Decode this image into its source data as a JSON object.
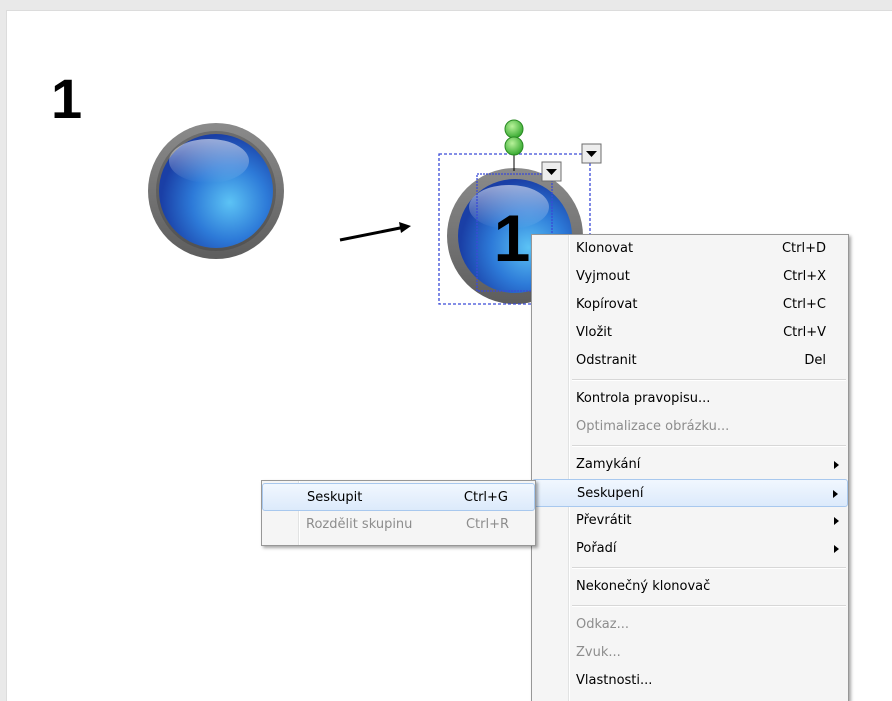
{
  "slide": {
    "page_number": "1",
    "badge_number": "1"
  },
  "context_menu": {
    "items": [
      {
        "label": "Klonovat",
        "shortcut": "Ctrl+D"
      },
      {
        "label": "Vyjmout",
        "shortcut": "Ctrl+X"
      },
      {
        "label": "Kopírovat",
        "shortcut": "Ctrl+C"
      },
      {
        "label": "Vložit",
        "shortcut": "Ctrl+V"
      },
      {
        "label": "Odstranit",
        "shortcut": "Del"
      },
      {
        "label": "Kontrola pravopisu..."
      },
      {
        "label": "Optimalizace obrázku..."
      },
      {
        "label": "Zamykání"
      },
      {
        "label": "Seskupení"
      },
      {
        "label": "Převrátit"
      },
      {
        "label": "Pořadí"
      },
      {
        "label": "Nekonečný klonovač"
      },
      {
        "label": "Odkaz..."
      },
      {
        "label": "Zvuk..."
      },
      {
        "label": "Vlastnosti..."
      }
    ]
  },
  "submenu": {
    "items": [
      {
        "label": "Seskupit",
        "shortcut": "Ctrl+G"
      },
      {
        "label": "Rozdělit skupinu",
        "shortcut": "Ctrl+R"
      }
    ]
  },
  "colors": {
    "accent_blue": "#2f7fd6",
    "ring_gray": "#7a7a7a",
    "rotate_handle_green": "#48c23a",
    "selection_blue": "#3a4ad8",
    "menu_highlight": "#dceafb"
  },
  "icons": [
    "rotate-handle-icon",
    "dropdown-arrow-icon",
    "submenu-arrow-icon"
  ]
}
